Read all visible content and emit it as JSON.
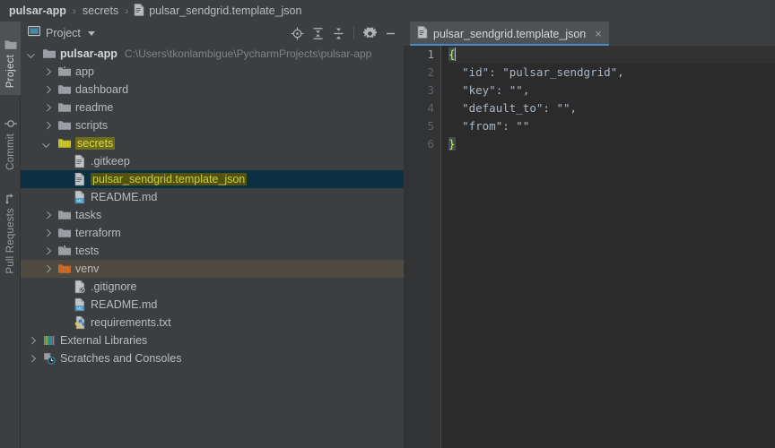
{
  "breadcrumb": {
    "items": [
      {
        "label": "pulsar-app",
        "bold": true,
        "icon": null
      },
      {
        "label": "secrets",
        "bold": false,
        "icon": null
      },
      {
        "label": "pulsar_sendgrid.template_json",
        "bold": false,
        "icon": "json-file-icon"
      }
    ],
    "separator": "›"
  },
  "tool_stripe": {
    "buttons": [
      {
        "label": "Project",
        "icon": "project-window-icon",
        "active": true
      },
      {
        "label": "Commit",
        "icon": "commit-icon",
        "active": false
      },
      {
        "label": "Pull Requests",
        "icon": "pull-request-icon",
        "active": false
      }
    ]
  },
  "project_panel": {
    "title": "Project",
    "toolbar_icons": [
      {
        "name": "select-opened-file-icon",
        "glyph": "target"
      },
      {
        "name": "expand-all-icon",
        "glyph": "expand"
      },
      {
        "name": "collapse-all-icon",
        "glyph": "collapse"
      },
      {
        "name": "settings-gear-icon",
        "glyph": "gear"
      },
      {
        "name": "hide-panel-icon",
        "glyph": "minus"
      }
    ],
    "tree": [
      {
        "label": "pulsar-app",
        "path": "C:\\Users\\tkonlambigue\\PycharmProjects\\pulsar-app",
        "indent": 0,
        "arrow": "open",
        "icon": "folder-icon",
        "bold": true,
        "state": "normal"
      },
      {
        "label": "app",
        "indent": 1,
        "arrow": "closed",
        "icon": "source-folder-icon",
        "state": "normal"
      },
      {
        "label": "dashboard",
        "indent": 1,
        "arrow": "closed",
        "icon": "folder-icon",
        "state": "normal"
      },
      {
        "label": "readme",
        "indent": 1,
        "arrow": "closed",
        "icon": "folder-icon",
        "state": "normal"
      },
      {
        "label": "scripts",
        "indent": 1,
        "arrow": "closed",
        "icon": "folder-icon",
        "state": "normal"
      },
      {
        "label": "secrets",
        "indent": 1,
        "arrow": "open",
        "icon": "folder-yellow-icon",
        "state": "highlighted"
      },
      {
        "label": ".gitkeep",
        "indent": 2,
        "arrow": "none",
        "icon": "text-file-icon",
        "state": "normal"
      },
      {
        "label": "pulsar_sendgrid.template_json",
        "indent": 2,
        "arrow": "none",
        "icon": "json-file-icon",
        "state": "selected"
      },
      {
        "label": "README.md",
        "indent": 2,
        "arrow": "none",
        "icon": "markdown-file-icon",
        "state": "normal"
      },
      {
        "label": "tasks",
        "indent": 1,
        "arrow": "closed",
        "icon": "folder-icon",
        "state": "normal"
      },
      {
        "label": "terraform",
        "indent": 1,
        "arrow": "closed",
        "icon": "folder-icon",
        "state": "normal"
      },
      {
        "label": "tests",
        "indent": 1,
        "arrow": "closed",
        "icon": "test-folder-icon",
        "state": "normal"
      },
      {
        "label": "venv",
        "indent": 1,
        "arrow": "closed",
        "icon": "folder-orange-icon",
        "state": "hovered"
      },
      {
        "label": ".gitignore",
        "indent": 2,
        "arrow": "none",
        "icon": "gitignore-file-icon",
        "state": "normal"
      },
      {
        "label": "README.md",
        "indent": 2,
        "arrow": "none",
        "icon": "markdown-file-icon",
        "state": "normal"
      },
      {
        "label": "requirements.txt",
        "indent": 2,
        "arrow": "none",
        "icon": "requirements-file-icon",
        "state": "normal"
      },
      {
        "label": "External Libraries",
        "indent": 0,
        "arrow": "closed",
        "icon": "external-libraries-icon",
        "state": "normal"
      },
      {
        "label": "Scratches and Consoles",
        "indent": 0,
        "arrow": "closed",
        "icon": "scratches-icon",
        "state": "normal"
      }
    ]
  },
  "editor": {
    "tab": {
      "label": "pulsar_sendgrid.template_json",
      "icon": "json-file-icon",
      "close": "×",
      "active": true
    },
    "line_numbers": [
      "1",
      "2",
      "3",
      "4",
      "5",
      "6"
    ],
    "current_line": 1,
    "lines": [
      [
        {
          "t": "{",
          "k": "brace"
        }
      ],
      [
        {
          "t": "  ",
          "k": "plain"
        },
        {
          "t": "\"id\"",
          "k": "key"
        },
        {
          "t": ": ",
          "k": "punc"
        },
        {
          "t": "\"pulsar_sendgrid\"",
          "k": "str"
        },
        {
          "t": ",",
          "k": "punc"
        }
      ],
      [
        {
          "t": "  ",
          "k": "plain"
        },
        {
          "t": "\"key\"",
          "k": "key"
        },
        {
          "t": ": ",
          "k": "punc"
        },
        {
          "t": "\"\"",
          "k": "str"
        },
        {
          "t": ",",
          "k": "punc"
        }
      ],
      [
        {
          "t": "  ",
          "k": "plain"
        },
        {
          "t": "\"default_to\"",
          "k": "key"
        },
        {
          "t": ": ",
          "k": "punc"
        },
        {
          "t": "\"\"",
          "k": "str"
        },
        {
          "t": ",",
          "k": "punc"
        }
      ],
      [
        {
          "t": "  ",
          "k": "plain"
        },
        {
          "t": "\"from\"",
          "k": "key"
        },
        {
          "t": ": ",
          "k": "punc"
        },
        {
          "t": "\"\"",
          "k": "str"
        }
      ],
      [
        {
          "t": "}",
          "k": "brace"
        }
      ]
    ]
  },
  "colors": {
    "window_bg": "#3c3f41",
    "editor_bg": "#2b2b2b",
    "gutter_bg": "#313335",
    "selection_bg": "#0d2f44",
    "hover_bg": "#4f4b41",
    "tab_active_underline": "#4a88c7",
    "highlight_yellow": "#6f6d1c",
    "brace_yellow": "#e8e83c",
    "text": "#bbbbbb"
  }
}
